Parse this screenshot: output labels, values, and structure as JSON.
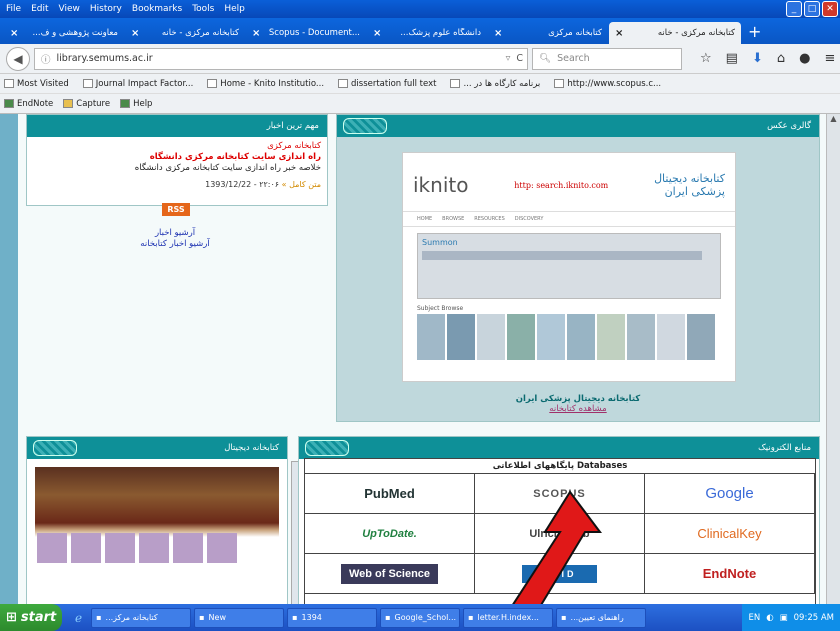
{
  "menubar": [
    "File",
    "Edit",
    "View",
    "History",
    "Bookmarks",
    "Tools",
    "Help"
  ],
  "tabs": [
    {
      "label": "...معاونت پژوهشی و ف"
    },
    {
      "label": "کتابخانه مرکزی - خانه"
    },
    {
      "label": "Scopus - Document..."
    },
    {
      "label": "...دانشگاه علوم پزشک"
    },
    {
      "label": "کتابخانه مرکزی"
    },
    {
      "label": "کتابخانه مرکزی - خانه"
    }
  ],
  "url": "library.semums.ac.ir",
  "search_placeholder": "Search",
  "bookmarks": [
    "Most Visited",
    "Journal Impact Factor...",
    "Home - Knito Institutio...",
    "dissertation full text",
    "... برنامه کارگاه ها در",
    "http://www.scopus.c..."
  ],
  "bookmarks2": [
    "EndNote",
    "Capture",
    "Help"
  ],
  "news": {
    "header": "مهم ترین اخبار",
    "line1": "کتابخانه مرکزی",
    "line2": "راه اندازی سایت کتابخانه مرکزی دانشگاه",
    "line3": "خلاصه خبر راه اندازی سایت کتابخانه مرکزی دانشگاه",
    "date": "۲۲:۰۶ - 1393/12/22",
    "more": "متن کامل »",
    "rss": "RSS",
    "archive1": "آرشیو اخبار",
    "archive2": "آرشیو اخبار کتابخانه"
  },
  "gallery": {
    "header": "گالری عکس",
    "knito_logo": "iknito",
    "knito_url": "http: search.iknito.com",
    "knito_title": "کتابخانه دیجیتال",
    "knito_sub": "پزشکی ایران",
    "nav": [
      "HOME",
      "BROWSE",
      "RESOURCES",
      "DISCOVERY"
    ],
    "summon": "Summon",
    "subject_browse": "Subject Browse",
    "caption1": "کتابخانه دیجیتال پزشکی ایران",
    "caption2": "مشاهده کتابخانه"
  },
  "digital_library": {
    "header": "کتابخانه دیجیتال"
  },
  "eresources": {
    "header": "منابع الکترونیک",
    "table_title": "پایگاههای اطلاعاتی  Databases",
    "items": [
      "PubMed",
      "SCOPUS",
      "Google",
      "UpToDate.",
      "UlrichsWeb",
      "ClinicalKey",
      "Web of Science",
      "OVID",
      "EndNote"
    ]
  },
  "taskbar": {
    "start": "start",
    "tasks": [
      "...کتابخانه مرکز",
      "New",
      "1394",
      "Google_Schol...",
      "letter.H.index...",
      "...راهنمای تعیین"
    ],
    "lang": "EN",
    "time": "09:25 AM"
  },
  "colors": {
    "accent": "#0e9098",
    "xpblue": "#0a5fd8",
    "red": "#e01818"
  }
}
